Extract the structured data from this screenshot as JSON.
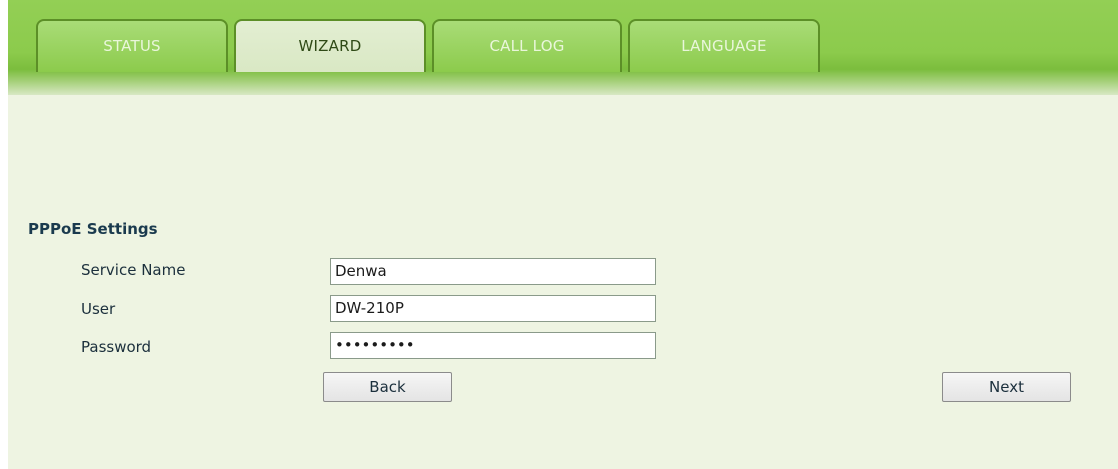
{
  "tabs": [
    {
      "label": "STATUS",
      "active": false
    },
    {
      "label": "WIZARD",
      "active": true
    },
    {
      "label": "CALL LOG",
      "active": false
    },
    {
      "label": "LANGUAGE",
      "active": false
    }
  ],
  "section": {
    "title": "PPPoE Settings"
  },
  "form": {
    "service_name": {
      "label": "Service Name",
      "value": "Denwa"
    },
    "user": {
      "label": "User",
      "value": "DW-210P"
    },
    "password": {
      "label": "Password",
      "value": "•••••••••"
    }
  },
  "buttons": {
    "back": "Back",
    "next": "Next"
  },
  "colors": {
    "header_green": "#8ccb4c",
    "tab_border": "#5c8f27",
    "page_background": "#eef4e2",
    "active_tab": "#dde9c9",
    "section_title": "#1a3a4e"
  }
}
